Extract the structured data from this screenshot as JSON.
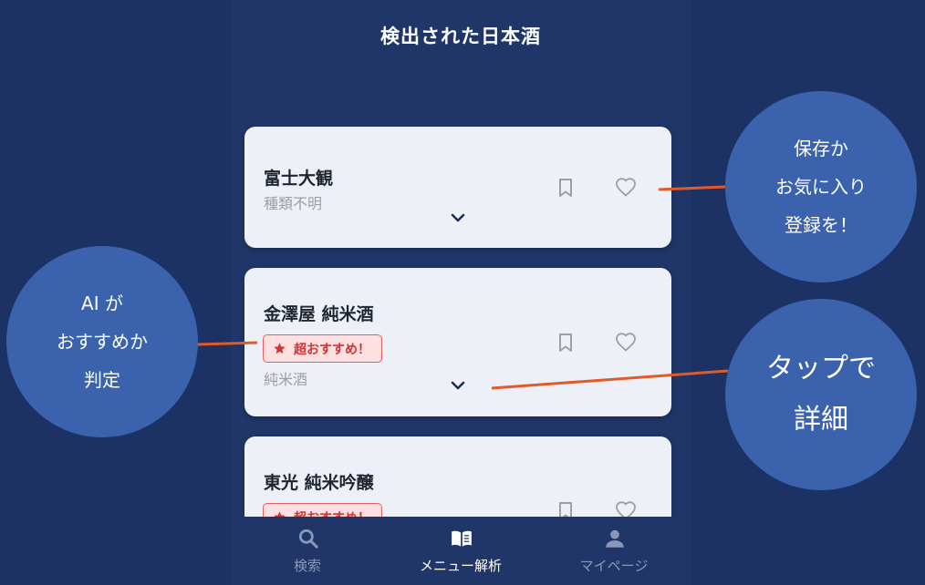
{
  "header": {
    "title": "検出された日本酒"
  },
  "cards": [
    {
      "name": "富士大観",
      "badge": "",
      "type": "種類不明"
    },
    {
      "name": "金澤屋 純米酒",
      "badge": "超おすすめ！",
      "type": "純米酒"
    },
    {
      "name": "東光 純米吟醸",
      "badge": "超おすすめ！",
      "type": ""
    }
  ],
  "bottom_nav": {
    "items": [
      {
        "label": "検索",
        "icon": "search-icon",
        "active": false
      },
      {
        "label": "メニュー解析",
        "icon": "book-icon",
        "active": true
      },
      {
        "label": "マイページ",
        "icon": "person-icon",
        "active": false
      }
    ]
  },
  "annotations": {
    "save": {
      "lines": [
        "保存か",
        "お気に入り",
        "登録を！"
      ]
    },
    "ai": {
      "lines": [
        "AI が",
        "おすすめか",
        "判定"
      ]
    },
    "tap": {
      "lines": [
        "タップで",
        "詳細"
      ]
    }
  },
  "colors": {
    "background": "#1c3265",
    "card": "#edf0f6",
    "badge_red": "#d23434",
    "bubble": "#3a62ad",
    "connector": "#e05a2a"
  }
}
